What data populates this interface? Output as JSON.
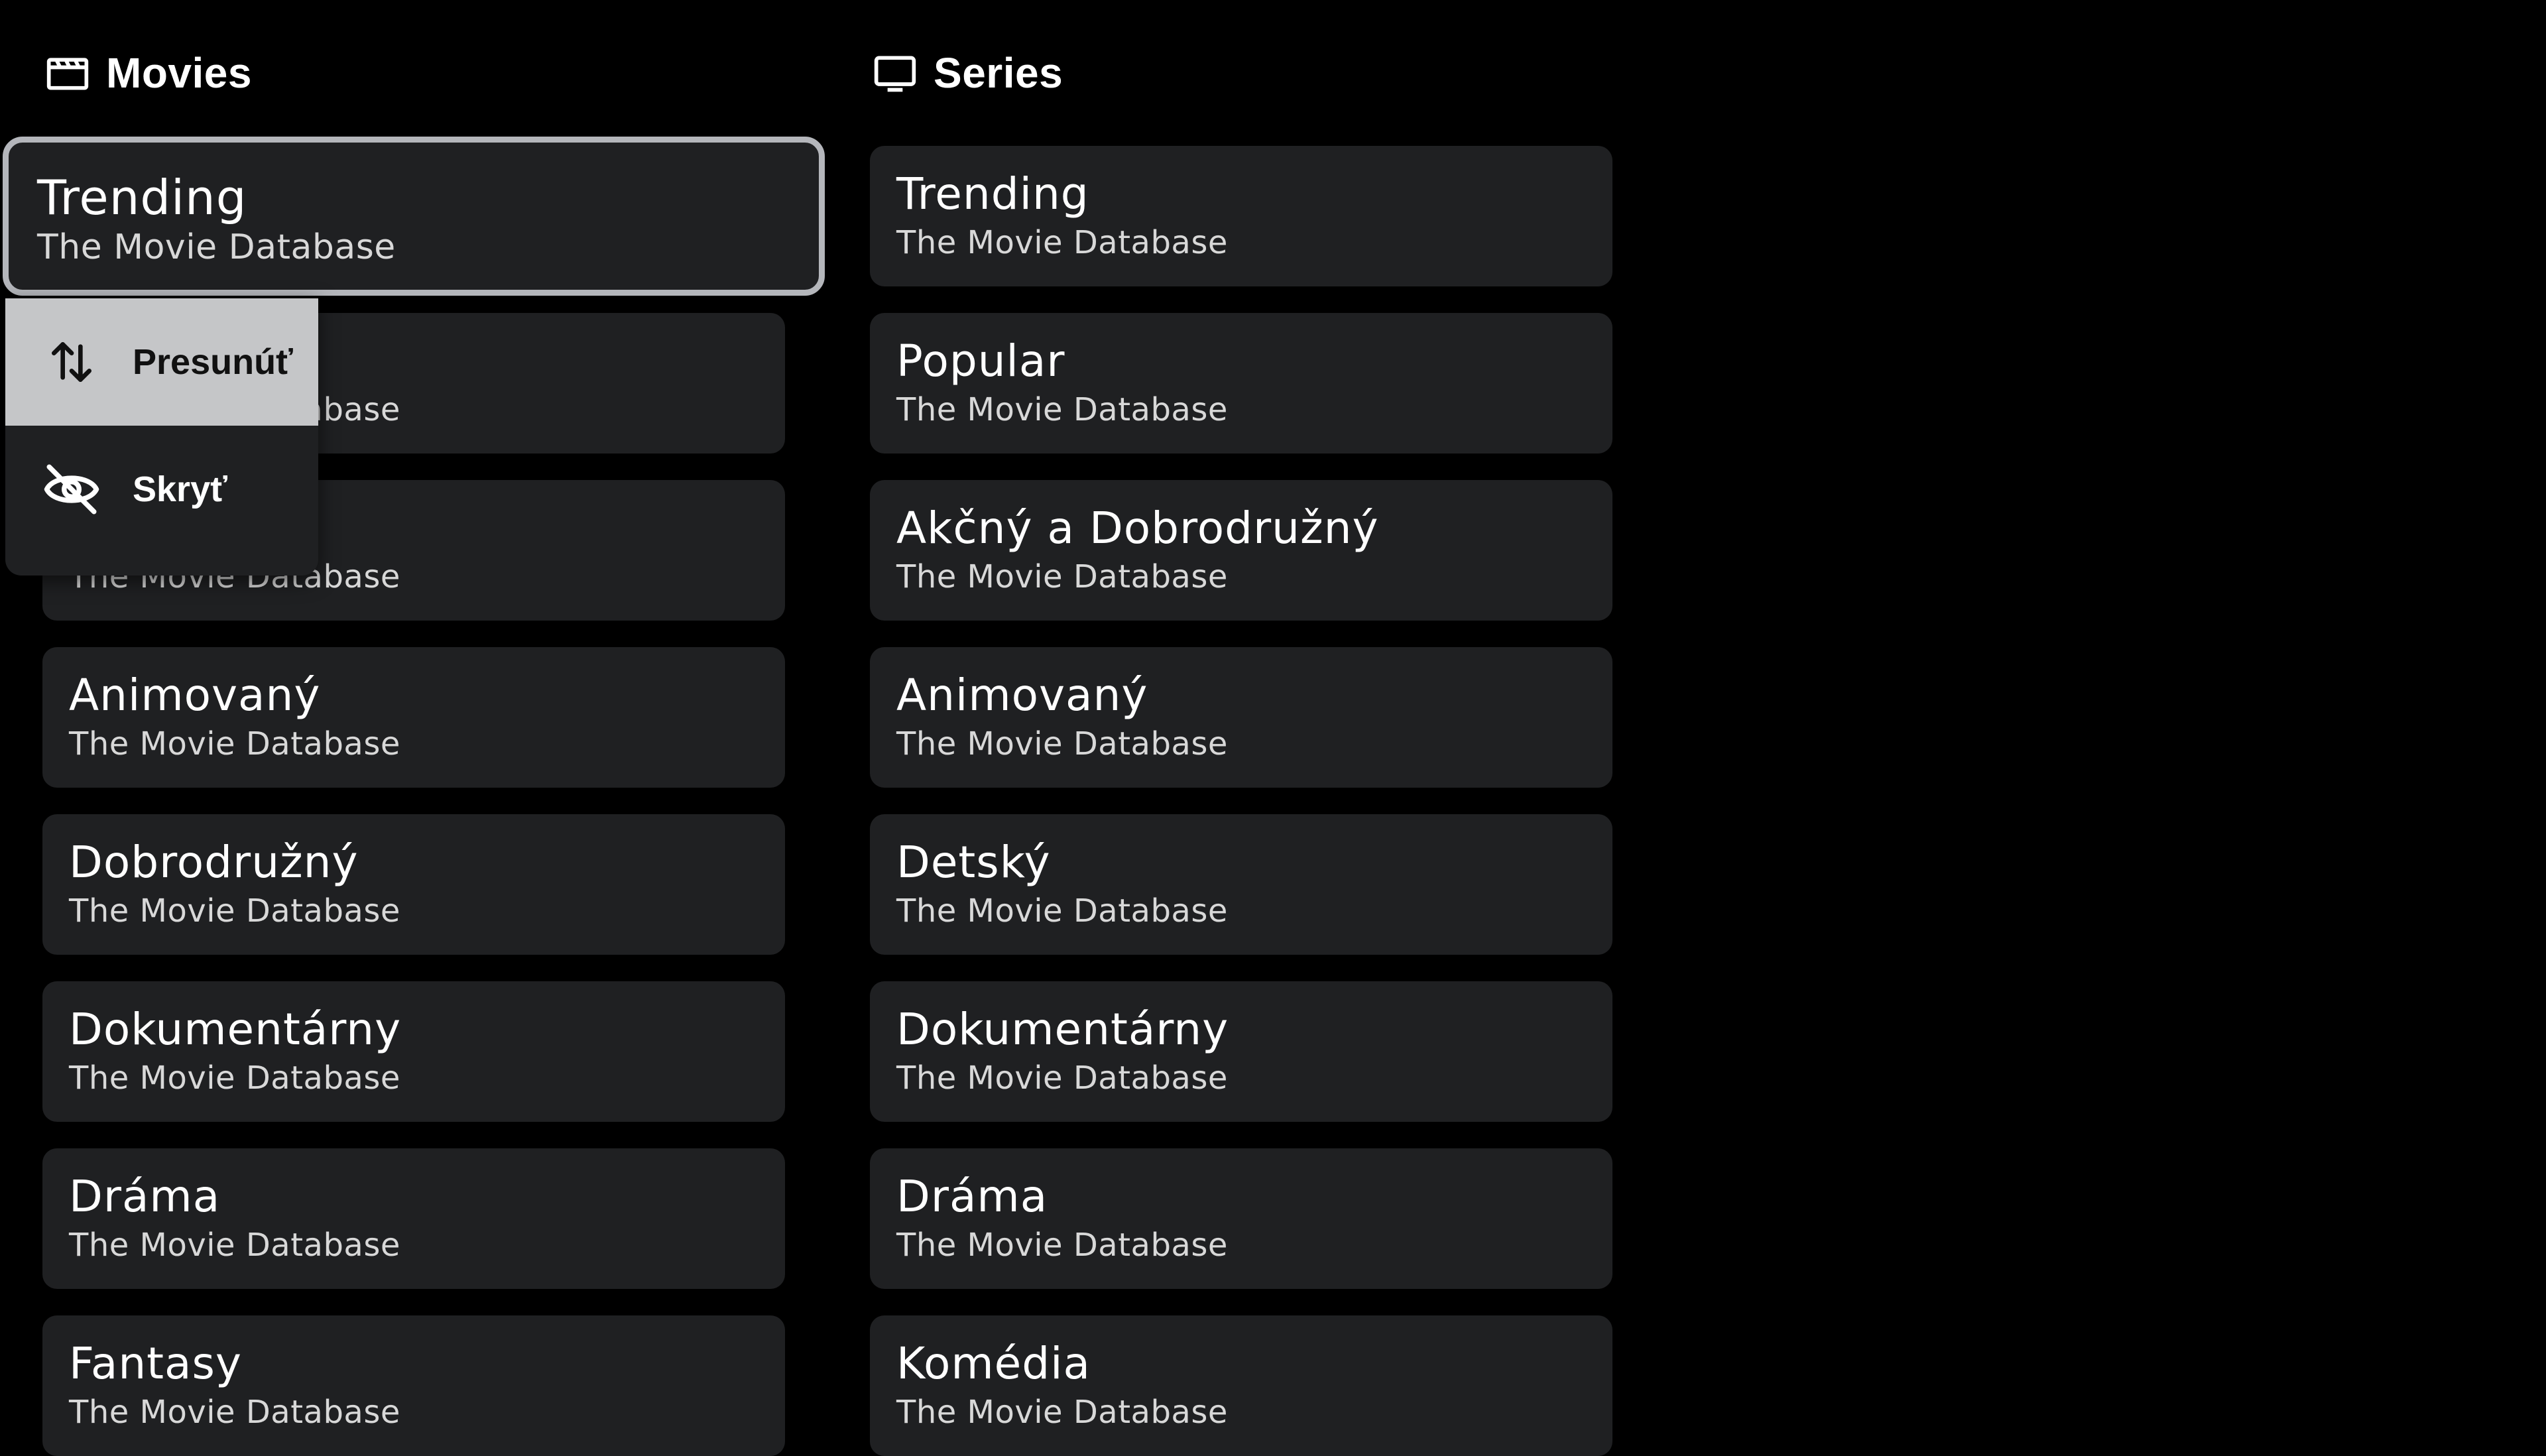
{
  "movies": {
    "title": "Movies",
    "icon": "movie-clapper-icon",
    "items": [
      {
        "name": "Trending",
        "source": "The Movie Database"
      },
      {
        "name": "",
        "source": "The Movie Database"
      },
      {
        "name": "",
        "source": "The Movie Database"
      },
      {
        "name": "Animovaný",
        "source": "The Movie Database"
      },
      {
        "name": "Dobrodružný",
        "source": "The Movie Database"
      },
      {
        "name": "Dokumentárny",
        "source": "The Movie Database"
      },
      {
        "name": "Dráma",
        "source": "The Movie Database"
      },
      {
        "name": "Fantasy",
        "source": "The Movie Database"
      }
    ]
  },
  "series": {
    "title": "Series",
    "icon": "tv-icon",
    "items": [
      {
        "name": "Trending",
        "source": "The Movie Database"
      },
      {
        "name": "Popular",
        "source": "The Movie Database"
      },
      {
        "name": "Akčný a Dobrodružný",
        "source": "The Movie Database"
      },
      {
        "name": "Animovaný",
        "source": "The Movie Database"
      },
      {
        "name": "Detský",
        "source": "The Movie Database"
      },
      {
        "name": "Dokumentárny",
        "source": "The Movie Database"
      },
      {
        "name": "Dráma",
        "source": "The Movie Database"
      },
      {
        "name": "Komédia",
        "source": "The Movie Database"
      }
    ]
  },
  "context_menu": {
    "items": [
      {
        "label": "Presunúť",
        "icon": "move-arrows-icon"
      },
      {
        "label": "Skryť",
        "icon": "eye-off-icon"
      }
    ]
  },
  "colors": {
    "background": "#000000",
    "card": "#1f2022",
    "focus_border": "#b4b6bb",
    "menu_highlight": "#c5c6c8"
  }
}
